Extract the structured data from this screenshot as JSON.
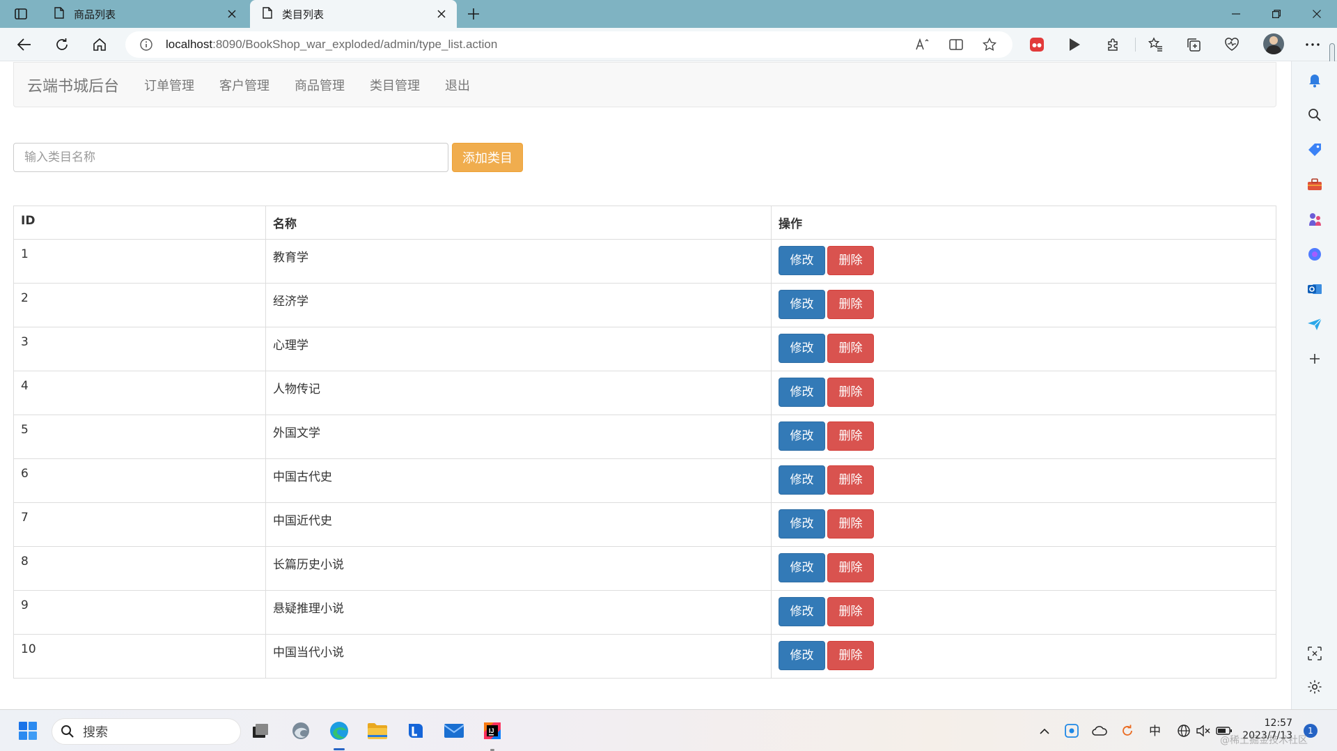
{
  "browser": {
    "tabs": [
      {
        "label": "商品列表",
        "active": false
      },
      {
        "label": "类目列表",
        "active": true
      }
    ],
    "url_host": "localhost",
    "url_rest": ":8090/BookShop_war_exploded/admin/type_list.action"
  },
  "nav": {
    "brand": "云端书城后台",
    "links": [
      "订单管理",
      "客户管理",
      "商品管理",
      "类目管理",
      "退出"
    ]
  },
  "form": {
    "placeholder": "输入类目名称",
    "value": "",
    "add_label": "添加类目"
  },
  "table": {
    "headers": [
      "ID",
      "名称",
      "操作"
    ],
    "edit_label": "修改",
    "delete_label": "删除",
    "rows": [
      {
        "id": "1",
        "name": "教育学"
      },
      {
        "id": "2",
        "name": "经济学"
      },
      {
        "id": "3",
        "name": "心理学"
      },
      {
        "id": "4",
        "name": "人物传记"
      },
      {
        "id": "5",
        "name": "外国文学"
      },
      {
        "id": "6",
        "name": "中国古代史"
      },
      {
        "id": "7",
        "name": "中国近代史"
      },
      {
        "id": "8",
        "name": "长篇历史小说"
      },
      {
        "id": "9",
        "name": "悬疑推理小说"
      },
      {
        "id": "10",
        "name": "中国当代小说"
      }
    ]
  },
  "taskbar": {
    "search_label": "搜索",
    "ime": "中",
    "time": "12:57",
    "date": "2023/7/13",
    "notification_count": "1"
  },
  "watermark": "@稀土掘金技术社区",
  "colors": {
    "edit_button": "#337ab7",
    "delete_button": "#d9534f",
    "add_button": "#f0ad4e",
    "tabstrip": "#7fb3c2"
  }
}
